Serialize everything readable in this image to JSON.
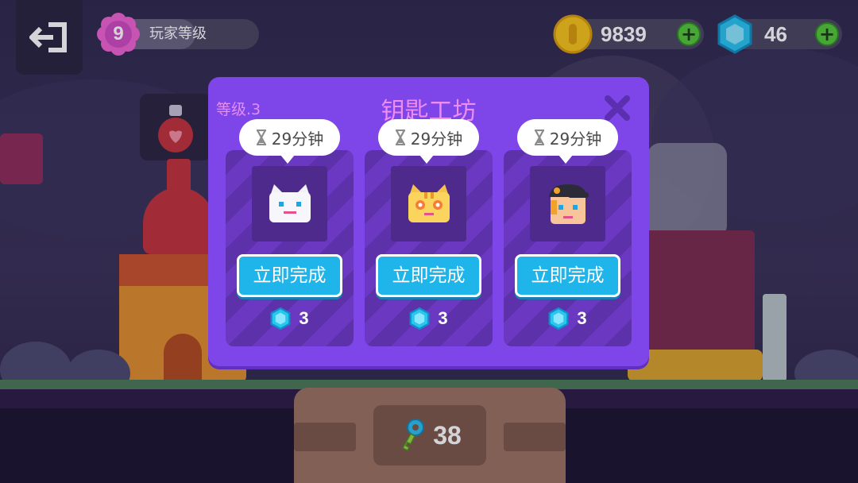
{
  "hud": {
    "exit_icon": "exit-door-icon",
    "player_level": {
      "level": "9",
      "label": "玩家等级",
      "progress": 0.55
    },
    "coins": {
      "value": "9839",
      "icon": "gold-coin-icon",
      "color": "#f7c51c"
    },
    "gems": {
      "value": "46",
      "icon": "blue-gem-icon",
      "color": "#29c6f2"
    }
  },
  "dialog": {
    "level_label": "等级.3",
    "title": "钥匙工坊",
    "close_icon": "close-x-icon",
    "slots": [
      {
        "timer": "29分钟",
        "character": "white-cat-head",
        "button_label": "立即完成",
        "cost": "3",
        "cost_icon": "blue-gem-icon"
      },
      {
        "timer": "29分钟",
        "character": "orange-cat-head",
        "button_label": "立即完成",
        "cost": "3",
        "cost_icon": "blue-gem-icon"
      },
      {
        "timer": "29分钟",
        "character": "boy-with-cap-head",
        "button_label": "立即完成",
        "cost": "3",
        "cost_icon": "blue-gem-icon"
      }
    ]
  },
  "keys": {
    "count": "38",
    "icon": "key-icon"
  },
  "colors": {
    "dialog_bg": "#7e45e8",
    "title": "#ee8cf2",
    "finish_button": "#1fb5ea",
    "plus_button": "#54c93a"
  }
}
